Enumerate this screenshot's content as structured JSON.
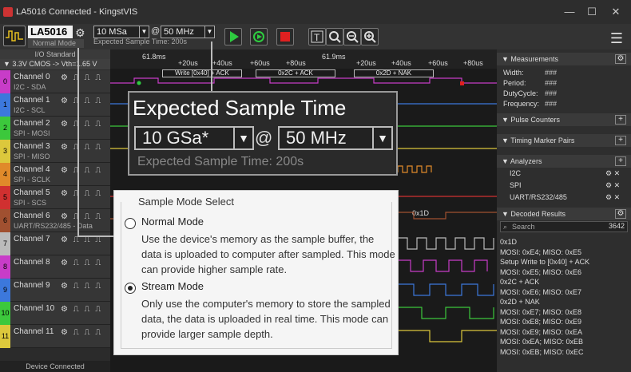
{
  "window": {
    "title": "LA5016 Connected - KingstVIS",
    "controls": [
      "—",
      "☐",
      "✕"
    ]
  },
  "toolbar": {
    "device_name": "LA5016",
    "device_mode": "Normal Mode",
    "sample_depth": "10 MSa",
    "at": "@",
    "sample_rate": "50 MHz",
    "expected_time": "Expected Sample Time: 200s"
  },
  "left_panel": {
    "io_standard": "I/O Standard",
    "cmos": "▼ 3.3V CMOS -> Vth=1.65 V",
    "channels": [
      {
        "num": "0",
        "name": "Channel 0",
        "sub": "I2C - SDA",
        "color": "#c83cc8"
      },
      {
        "num": "1",
        "name": "Channel 1",
        "sub": "I2C - SCL",
        "color": "#3c78dc"
      },
      {
        "num": "2",
        "name": "Channel 2",
        "sub": "SPI - MOSI",
        "color": "#3cc83c"
      },
      {
        "num": "3",
        "name": "Channel 3",
        "sub": "SPI - MISO",
        "color": "#dcc83c"
      },
      {
        "num": "4",
        "name": "Channel 4",
        "sub": "SPI - SCLK",
        "color": "#e08a2a"
      },
      {
        "num": "5",
        "name": "Channel 5",
        "sub": "SPI - SCS",
        "color": "#d03030"
      },
      {
        "num": "6",
        "name": "Channel 6",
        "sub": "UART/RS232/485 - Data",
        "color": "#a05030"
      },
      {
        "num": "7",
        "name": "Channel 7",
        "sub": "",
        "color": "#bbbbbb"
      },
      {
        "num": "8",
        "name": "Channel 8",
        "sub": "",
        "color": "#c83cc8"
      },
      {
        "num": "9",
        "name": "Channel 9",
        "sub": "",
        "color": "#3c78dc"
      },
      {
        "num": "10",
        "name": "Channel 10",
        "sub": "",
        "color": "#3cc83c"
      },
      {
        "num": "11",
        "name": "Channel 11",
        "sub": "",
        "color": "#dcc83c"
      }
    ],
    "status": "Device Connected"
  },
  "ruler": {
    "marks": [
      "61.8ms",
      "+20us",
      "+40us",
      "+60us",
      "+80us",
      "61.9ms",
      "+20us",
      "+40us",
      "+60us",
      "+80us"
    ],
    "protocol": [
      "Write [0x40] + ACK",
      "0x2C + ACK",
      "0x2D + NAK",
      "0x1D"
    ]
  },
  "right_panel": {
    "measurements": "Measurements",
    "fields": [
      {
        "label": "Width:",
        "value": "###"
      },
      {
        "label": "Period:",
        "value": "###"
      },
      {
        "label": "DutyCycle:",
        "value": "###"
      },
      {
        "label": "Frequency:",
        "value": "###"
      }
    ],
    "pulse_counters": "Pulse Counters",
    "timing_pairs": "Timing Marker Pairs",
    "analyzers": "Analyzers",
    "analyzer_list": [
      "I2C",
      "SPI",
      "UART/RS232/485"
    ],
    "decoded_results": "Decoded Results",
    "search_placeholder": "Search",
    "count": "3642",
    "decoded": [
      "0x1D",
      "MOSI: 0xE4;  MISO: 0xE5",
      "Setup Write to [0x40] + ACK",
      "MOSI: 0xE5;  MISO: 0xE6",
      "0x2C + ACK",
      "MOSI: 0xE6;  MISO: 0xE7",
      "0x2D + NAK",
      "MOSI: 0xE7;  MISO: 0xE8",
      "MOSI: 0xE8;  MISO: 0xE9",
      "MOSI: 0xE9;  MISO: 0xEA",
      "MOSI: 0xEA;  MISO: 0xEB",
      "MOSI: 0xEB;  MISO: 0xEC"
    ]
  },
  "callout_time": {
    "title": "Expected Sample Time",
    "depth": "10 GSa*",
    "at": "@",
    "rate": "50 MHz",
    "expected": "Expected Sample Time: 200s"
  },
  "callout_mode": {
    "title": "Sample Mode Select",
    "normal_label": "Normal Mode",
    "normal_desc": "Use the device's memory as the sample buffer, the data is uploaded to computer after sampled. This mode can provide higher sample rate.",
    "stream_label": "Stream Mode",
    "stream_desc": "Only use the computer's memory to store the sampled data, the data is uploaded in real time. This mode can provide larger sample depth."
  }
}
